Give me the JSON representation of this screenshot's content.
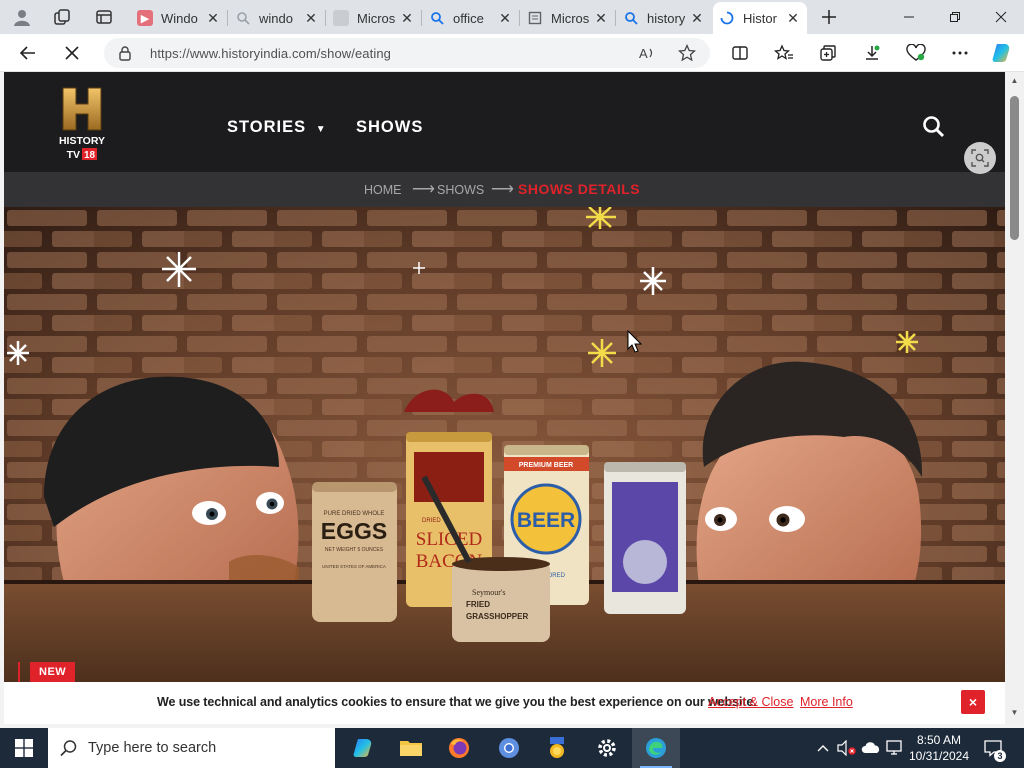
{
  "browser": {
    "tabs": [
      {
        "title": "Windo",
        "favicon": "youtube-icon",
        "color": "#e0393e"
      },
      {
        "title": "windo",
        "favicon": "search-icon",
        "color": "#9aa0a6"
      },
      {
        "title": "Micros",
        "favicon": "page-icon",
        "color": "#8a8d91"
      },
      {
        "title": "office",
        "favicon": "bing-search-icon",
        "color": "#1a73e8"
      },
      {
        "title": "Micros",
        "favicon": "document-icon",
        "color": "#5f6368"
      },
      {
        "title": "history",
        "favicon": "bing-search-icon",
        "color": "#1a73e8"
      },
      {
        "title": "Histor",
        "favicon": "loading-icon",
        "color": "#1a73e8"
      }
    ],
    "url": "https://www.historyindia.com/show/eating"
  },
  "site": {
    "logo": {
      "line1": "HISTORY",
      "line2": "TV",
      "badge": "18"
    },
    "nav": {
      "stories": "STORIES",
      "shows": "SHOWS"
    },
    "breadcrumb": {
      "home": "HOME",
      "shows": "SHOWS",
      "current": "SHOWS DETAILS"
    },
    "new_badge": "NEW",
    "cans": {
      "eggs_top": "PURE DRIED WHOLE",
      "eggs": "EGGS",
      "eggs_sub": "NET WEIGHT 5 OUNCES",
      "eggs_sub2": "UNITED STATES OF AMERICA",
      "bacon_top": "DRIED",
      "bacon1": "SLICED",
      "bacon2": "BACON",
      "beer_top": "PREMIUM BEER",
      "beer": "BEER",
      "beer_sub": "FLAVORED",
      "grass1": "Seymour's",
      "grass2": "FRIED",
      "grass3": "GRASSHOPPER"
    },
    "cookie": {
      "message": "We use technical and analytics cookies to ensure that we give you the best experience on our website.",
      "accept": "Accept & Close",
      "more": "More Info",
      "close": "×"
    }
  },
  "taskbar": {
    "search_placeholder": "Type here to search",
    "time": "8:50 AM",
    "date": "10/31/2024",
    "notifications": "3"
  },
  "colors": {
    "accent_red": "#e0222a",
    "header_bg": "#1c1c1e",
    "crumb_bg": "#333336",
    "taskbar_bg": "#1d2a3a"
  }
}
